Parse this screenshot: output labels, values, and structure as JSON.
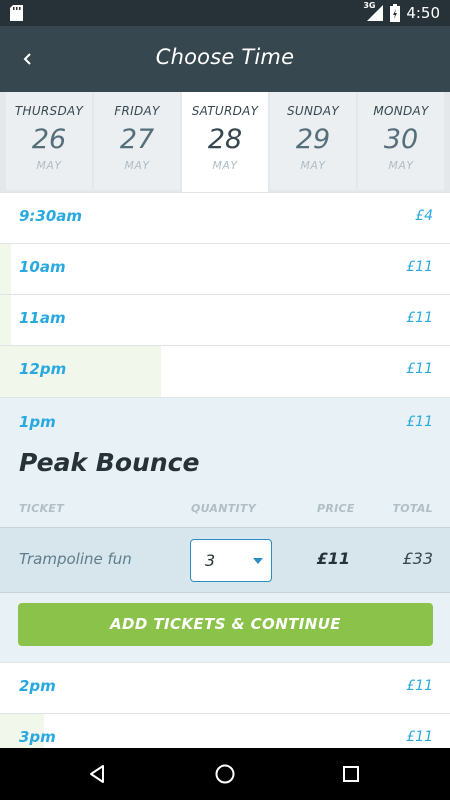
{
  "status": {
    "network": "3G",
    "time": "4:50"
  },
  "header": {
    "title": "Choose Time"
  },
  "days": [
    {
      "name": "THURSDAY",
      "date": "26",
      "month": "MAY"
    },
    {
      "name": "FRIDAY",
      "date": "27",
      "month": "MAY"
    },
    {
      "name": "SATURDAY",
      "date": "28",
      "month": "MAY",
      "selected": true
    },
    {
      "name": "SUNDAY",
      "date": "29",
      "month": "MAY"
    },
    {
      "name": "MONDAY",
      "date": "30",
      "month": "MAY"
    }
  ],
  "slots": [
    {
      "time": "9:30am",
      "price": "£4"
    },
    {
      "time": "10am",
      "price": "£11"
    },
    {
      "time": "11am",
      "price": "£11"
    },
    {
      "time": "12pm",
      "price": "£11"
    },
    {
      "time": "1pm",
      "price": "£11"
    },
    {
      "time": "2pm",
      "price": "£11"
    },
    {
      "time": "3pm",
      "price": "£11"
    }
  ],
  "selected_slot": {
    "event": "Peak Bounce",
    "headers": {
      "ticket": "TICKET",
      "quantity": "QUANTITY",
      "price": "PRICE",
      "total": "TOTAL"
    },
    "ticket": {
      "name": "Trampoline fun",
      "quantity": "3",
      "price": "£11",
      "total": "£33"
    },
    "button": "ADD TICKETS & CONTINUE"
  },
  "colors": {
    "accent": "#29a9df",
    "button": "#8bc34a",
    "appbar": "#37474f",
    "statusbar": "#263238"
  }
}
